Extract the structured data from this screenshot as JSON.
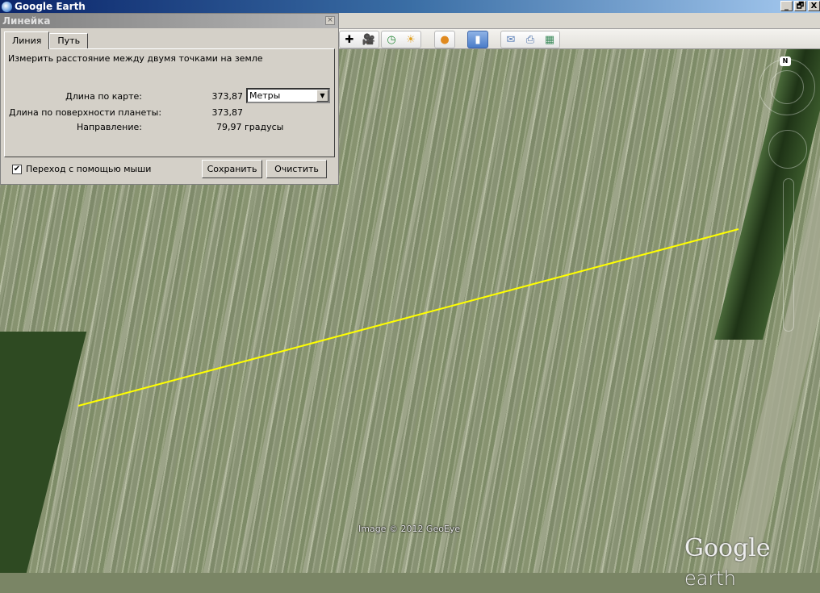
{
  "app": {
    "title": "Google Earth",
    "window_buttons": [
      "_",
      "🗗",
      "X"
    ]
  },
  "toolbar": {
    "icons": [
      "add-path-icon",
      "add-tour-icon",
      "historical-imagery-icon",
      "sunlight-icon",
      "planets-icon",
      "ruler-icon",
      "email-icon",
      "print-icon",
      "view-in-maps-icon"
    ]
  },
  "ruler_dialog": {
    "title": "Линейка",
    "close": "×",
    "tabs": [
      {
        "label": "Линия",
        "active": true
      },
      {
        "label": "Путь",
        "active": false
      }
    ],
    "description": "Измерить расстояние между двумя точками на земле",
    "map_length_label": "Длина по карте:",
    "map_length_value": "373,87",
    "unit_selected": "Метры",
    "surface_length_label": "Длина по поверхности планеты:",
    "surface_length_value": "373,87",
    "heading_label": "Направление:",
    "heading_value": "79,97 градусы",
    "mouse_nav_label": "Переход с помощью мыши",
    "mouse_nav_checked": true,
    "save_label": "Сохранить",
    "clear_label": "Очистить"
  },
  "map": {
    "north_label": "N",
    "credit": "Image © 2012 GeoEye",
    "logo_google": "Google",
    "logo_earth": "earth",
    "line_color": "#ffff00"
  }
}
